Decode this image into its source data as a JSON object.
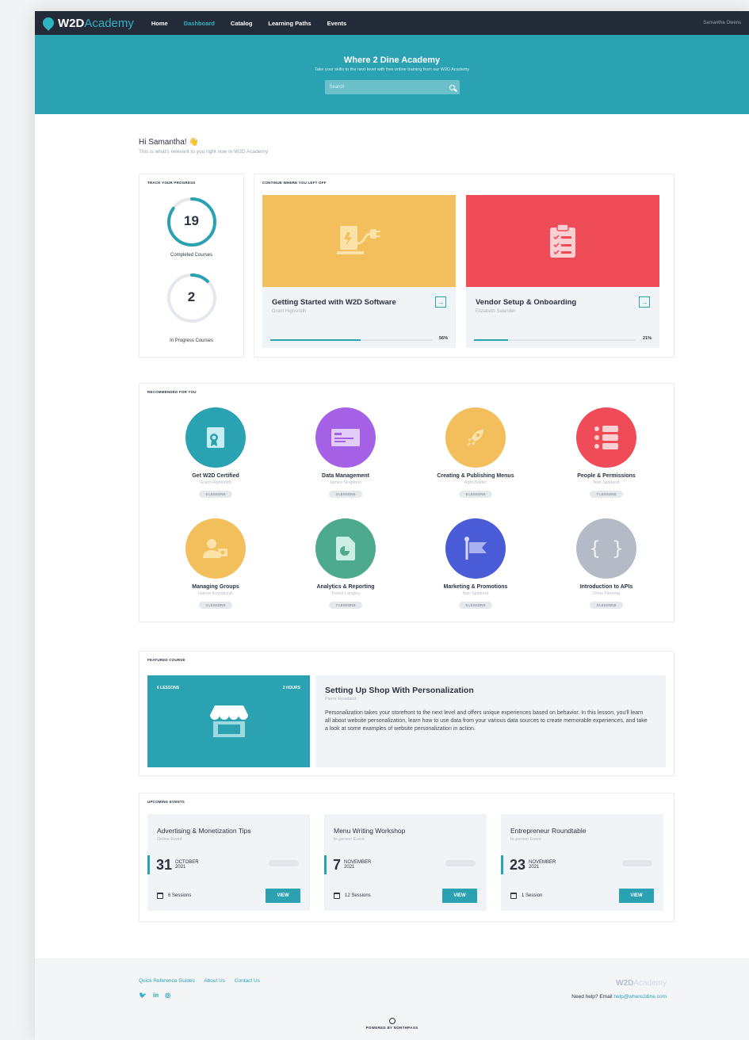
{
  "nav": {
    "brand_bold": "W2D",
    "brand_light": "Academy",
    "items": [
      "Home",
      "Dashboard",
      "Catalog",
      "Learning Paths",
      "Events"
    ],
    "active": "Dashboard",
    "user": "Samantha Owens"
  },
  "hero": {
    "title": "Where 2 Dine Academy",
    "subtitle": "Take your skills to the next level with free online training from our W2D Academy",
    "search_placeholder": "Search"
  },
  "greeting": {
    "title": "Hi Samantha! 👋",
    "subtitle": "This is what's relevant to you right now in W2D Academy"
  },
  "progress": {
    "title": "Track Your Progress",
    "completed": {
      "count": "19",
      "label": "Completed Courses",
      "fraction": 0.85
    },
    "in_progress": {
      "count": "2",
      "label": "In Progress Courses",
      "fraction": 0.12
    }
  },
  "continue": {
    "title": "Continue Where You Left Off",
    "courses": [
      {
        "title": "Getting Started with W2D Software",
        "author": "Grant Highsmith",
        "percent": "56%",
        "progress": 0.56,
        "color": "#f2bf5c"
      },
      {
        "title": "Vendor Setup & Onboarding",
        "author": "Elizabeth Salander",
        "percent": "21%",
        "progress": 0.21,
        "color": "#ef4c57"
      }
    ]
  },
  "recommended": {
    "title": "Recommended For You",
    "items": [
      {
        "title": "Get W2D Certified",
        "author": "Grant Highsmith",
        "lessons": "6 Lessons",
        "color": "#2aa2b1",
        "icon": "certificate-icon"
      },
      {
        "title": "Data Management",
        "author": "James Singleton",
        "lessons": "3 Lessons",
        "color": "#a561e6",
        "icon": "card-icon"
      },
      {
        "title": "Creating & Publishing Menus",
        "author": "April Bolder",
        "lessons": "9 Lessons",
        "color": "#f2bf5c",
        "icon": "rocket-icon"
      },
      {
        "title": "People & Permissions",
        "author": "Nan Sjoklund",
        "lessons": "7 Lessons",
        "color": "#ef4c57",
        "icon": "list-icon"
      },
      {
        "title": "Managing Groups",
        "author": "Hanna Kowalczyk",
        "lessons": "4 Lessons",
        "color": "#f2bf5c",
        "icon": "users-icon"
      },
      {
        "title": "Analytics & Reporting",
        "author": "Trevor Langley",
        "lessons": "7 Lessons",
        "color": "#4daa8c",
        "icon": "report-icon"
      },
      {
        "title": "Marketing & Promotions",
        "author": "Nan Sjoklund",
        "lessons": "6 Lessons",
        "color": "#4a5bd8",
        "icon": "flag-icon"
      },
      {
        "title": "Introduction to APIs",
        "author": "Drew Fleming",
        "lessons": "3 Lessons",
        "color": "#b4bac6",
        "icon": "braces-icon"
      }
    ]
  },
  "featured": {
    "title": "Featured Course",
    "lessons": "6 Lessons",
    "hours": "2 Hours",
    "course_title": "Setting Up Shop With Personalization",
    "author": "Pierre Roseland",
    "description": "Personalization takes your storefront to the next level and offers unique experiences based on behavior. In this lesson, you'll learn all about website personalization, learn how to use data from your various data sources to create memorable experiences, and take a look at some examples of website personalization in action."
  },
  "events": {
    "title": "Upcoming Events",
    "items": [
      {
        "title": "Advertising & Monetization Tips",
        "kind": "Online Event",
        "day": "31",
        "month": "October",
        "year": "2021",
        "sessions": "6 Sessions",
        "button": "VIEW"
      },
      {
        "title": "Menu Writing Workshop",
        "kind": "In-person Event",
        "day": "7",
        "month": "November",
        "year": "2021",
        "sessions": "12 Sessions",
        "button": "VIEW"
      },
      {
        "title": "Entrepreneur Roundtable",
        "kind": "In-person Event",
        "day": "23",
        "month": "November",
        "year": "2021",
        "sessions": "1 Session",
        "button": "VIEW"
      }
    ]
  },
  "footer": {
    "links": [
      "Quick Reference Guides",
      "About Us",
      "Contact Us"
    ],
    "social": [
      "twitter-icon",
      "linkedin-icon",
      "instagram-icon"
    ],
    "logo_bold": "W2D",
    "logo_light": "Academy",
    "help_text": "Need help? Email",
    "help_email": "help@where2dine.com",
    "powered": "POWERED BY NORTHPASS"
  }
}
